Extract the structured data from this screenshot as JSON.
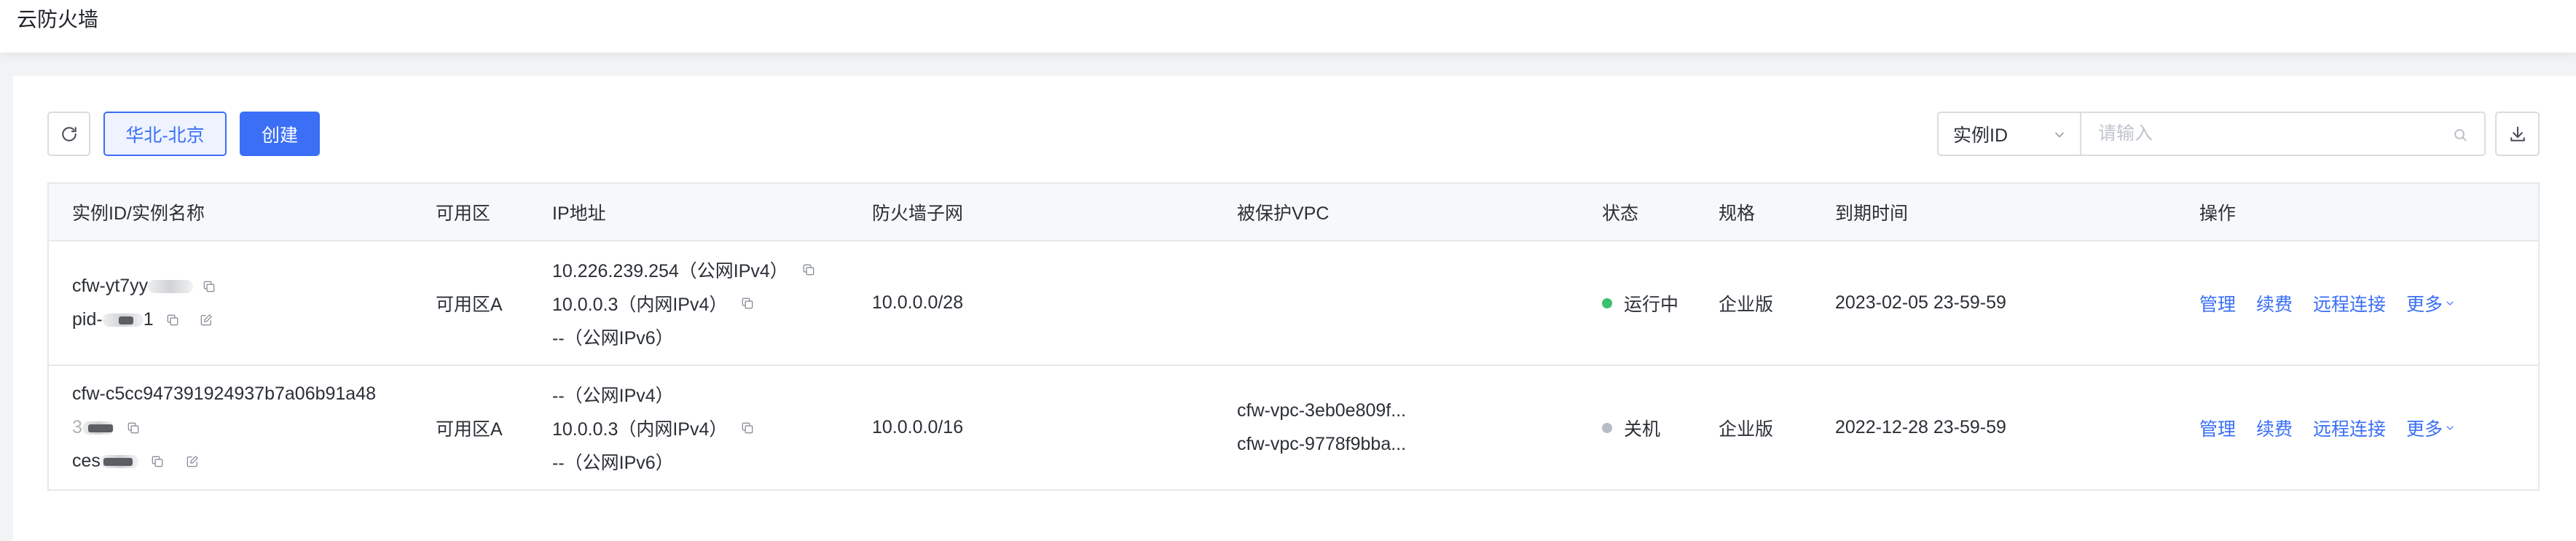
{
  "app": {
    "title": "云防火墙"
  },
  "toolbar": {
    "region": "华北-北京",
    "create": "创建",
    "filter_field": "实例ID",
    "search_placeholder": "请输入"
  },
  "table": {
    "columns": [
      "实例ID/实例名称",
      "可用区",
      "IP地址",
      "防火墙子网",
      "被保护VPC",
      "状态",
      "规格",
      "到期时间",
      "操作"
    ],
    "rows": [
      {
        "instance_id": "cfw-yt7yy",
        "instance_name_prefix": "pid-",
        "instance_name_suffix": "1",
        "zone": "可用区A",
        "ips": [
          "10.226.239.254（公网IPv4）",
          "10.0.0.3（内网IPv4）",
          "--（公网IPv6）"
        ],
        "subnet": "10.0.0.0/28",
        "vpcs": [],
        "status": "运行中",
        "status_color": "#3cc06e",
        "spec": "企业版",
        "expire": "2023-02-05 23-59-59",
        "actions": [
          "管理",
          "续费",
          "远程连接",
          "更多"
        ]
      },
      {
        "instance_id": "cfw-c5cc947391924937b7a06b91a48",
        "instance_id_cont": "3",
        "instance_name_prefix": "ces",
        "zone": "可用区A",
        "ips": [
          "--（公网IPv4）",
          "10.0.0.3（内网IPv4）",
          "--（公网IPv6）"
        ],
        "subnet": "10.0.0.0/16",
        "vpcs": [
          "cfw-vpc-3eb0e809f...",
          "cfw-vpc-9778f9bba..."
        ],
        "status": "关机",
        "status_color": "#b8bcc4",
        "spec": "企业版",
        "expire": "2022-12-28 23-59-59",
        "actions": [
          "管理",
          "续费",
          "远程连接",
          "更多"
        ]
      }
    ]
  },
  "colors": {
    "primary": "#3a6ff6",
    "page_bg": "#f2f3f5",
    "running": "#3cc06e",
    "stopped": "#b8bcc4"
  },
  "icons": [
    "refresh-icon",
    "chevron-down-icon",
    "search-icon",
    "download-icon",
    "copy-icon",
    "edit-icon"
  ]
}
